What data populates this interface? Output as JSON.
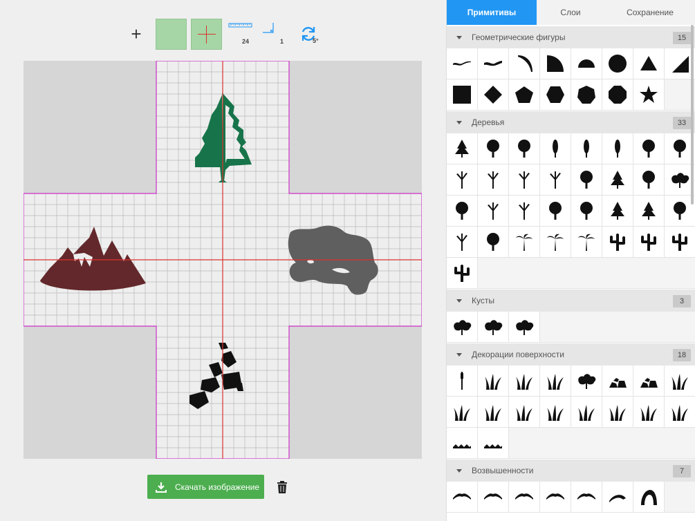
{
  "toolbar": {
    "add_icon": "plus-icon",
    "ruler_value": "24",
    "angle_value": "1",
    "rotate_value": "5°",
    "colors": {
      "accent_green": "#a6d6a5",
      "cross_red": "#d9322f",
      "ruler_blue": "#2196f3"
    }
  },
  "canvas": {
    "colors": {
      "background": "#d6d6d6",
      "grid_fill": "#eeeeee",
      "grid_line": "#b5b5b5",
      "border": "#cc2fc8",
      "center_line": "#d9322f"
    },
    "objects": [
      {
        "name": "pine-tree",
        "color": "#17744a"
      },
      {
        "name": "mountain",
        "color": "#63282b"
      },
      {
        "name": "lake",
        "color": "#5f5f5f"
      },
      {
        "name": "rocks",
        "color": "#111111"
      }
    ]
  },
  "actions": {
    "download_label": "Скачать изображение",
    "download_icon": "download-icon",
    "delete_icon": "trash-icon",
    "download_color": "#4cae4f"
  },
  "panel": {
    "tabs": [
      {
        "label": "Примитивы",
        "active": true
      },
      {
        "label": "Слои",
        "active": false
      },
      {
        "label": "Сохранение",
        "active": false
      }
    ],
    "active_tab_color": "#2196f3",
    "sections": [
      {
        "title": "Геометрические фигуры",
        "count": "15",
        "items": [
          "curve-thin-shape",
          "curve-thick-shape",
          "quarter-arc-shape",
          "quarter-circle-shape",
          "half-circle-shape",
          "circle-shape",
          "triangle-shape",
          "right-triangle-shape",
          "square-shape",
          "diamond-shape",
          "pentagon-shape",
          "hexagon-shape",
          "heptagon-shape",
          "octagon-shape",
          "star-shape"
        ]
      },
      {
        "title": "Деревья",
        "count": "33",
        "items": [
          "pine-tree-icon",
          "round-tree-icon",
          "bonsai-icon",
          "poplar-icon",
          "cypress-icon",
          "slim-tree-icon",
          "acacia-icon",
          "umbrella-tree-icon",
          "dead-tree-icon",
          "broken-trunk-icon",
          "bare-tree-icon",
          "stump-icon",
          "willow-icon",
          "fir-icon",
          "oak-icon",
          "bush-tree-icon",
          "cloud-tree-icon",
          "branch-tree-icon",
          "twig-tree-icon",
          "round-oak-icon",
          "oval-tree-icon",
          "cone-tree-icon",
          "spruce-icon",
          "curly-tree-icon",
          "baobab-icon",
          "mushroom-tree-icon",
          "palm-icon",
          "palm-leaning-icon",
          "palm-tall-icon",
          "cactus-icon",
          "saguaro-icon",
          "small-cactus-icon",
          "barrel-cactus-icon"
        ]
      },
      {
        "title": "Кусты",
        "count": "3",
        "items": [
          "bush-round-icon",
          "bush-wide-icon",
          "shrub-icon"
        ]
      },
      {
        "title": "Декорации поверхности",
        "count": "18",
        "items": [
          "reed-icon",
          "sprout-icon",
          "weed-icon",
          "coral-icon",
          "dry-bush-icon",
          "rocks-icon",
          "rock-path-icon",
          "grass-tuft-icon",
          "flower-icon",
          "lily-icon",
          "grass-icon",
          "grass-bent-icon",
          "grass-fan-icon",
          "grass-long-icon",
          "grass-blade-icon",
          "agave-icon",
          "waves-icon",
          "water-icon"
        ]
      },
      {
        "title": "Возвышенности",
        "count": "7",
        "items": [
          "ridge-1-icon",
          "ridge-2-icon",
          "ridge-3-icon",
          "ridge-4-icon",
          "ridge-5-icon",
          "hook-ridge-icon",
          "arch-icon"
        ]
      }
    ]
  }
}
